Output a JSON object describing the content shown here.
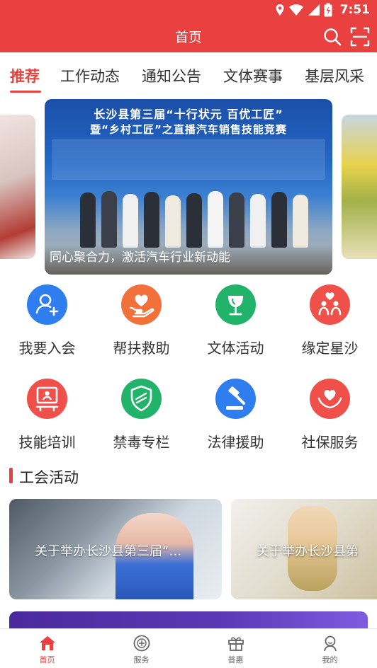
{
  "status_bar": {
    "time": "7:51"
  },
  "header": {
    "title": "首页"
  },
  "tabs": [
    {
      "label": "推荐",
      "active": true
    },
    {
      "label": "工作动态",
      "active": false
    },
    {
      "label": "通知公告",
      "active": false
    },
    {
      "label": "文体赛事",
      "active": false
    },
    {
      "label": "基层风采",
      "active": false
    }
  ],
  "carousel": {
    "banner_line1": "长沙县第三届“十行状元 百优工匠”",
    "banner_line2": "暨“乡村工匠”之直播汽车销售技能竞赛",
    "caption": "同心聚合力，激活汽车行业新动能"
  },
  "services": [
    {
      "label": "我要入会",
      "icon": "add-member-icon",
      "color": "#2f7ef0"
    },
    {
      "label": "帮扶救助",
      "icon": "heart-hand-icon",
      "color": "#f2703a"
    },
    {
      "label": "文体活动",
      "icon": "trophy-icon",
      "color": "#22b36a"
    },
    {
      "label": "缘定星沙",
      "icon": "couple-heart-icon",
      "color": "#f0504a"
    },
    {
      "label": "技能培训",
      "icon": "training-icon",
      "color": "#f0504a"
    },
    {
      "label": "禁毒专栏",
      "icon": "shield-icon",
      "color": "#22b36a"
    },
    {
      "label": "法律援助",
      "icon": "gavel-icon",
      "color": "#2f7ef0"
    },
    {
      "label": "社保服务",
      "icon": "care-heart-icon",
      "color": "#f0504a"
    }
  ],
  "section": {
    "title": "工会活动"
  },
  "activities": [
    {
      "title": "关于举办长沙县第三届“…"
    },
    {
      "title": "关于举办长沙县第"
    }
  ],
  "bottom_nav": [
    {
      "label": "首页",
      "icon": "home-icon",
      "active": true
    },
    {
      "label": "服务",
      "icon": "union-badge-icon",
      "active": false
    },
    {
      "label": "普惠",
      "icon": "gift-icon",
      "active": false
    },
    {
      "label": "我的",
      "icon": "profile-icon",
      "active": false
    }
  ],
  "colors": {
    "primary": "#e8413f"
  }
}
